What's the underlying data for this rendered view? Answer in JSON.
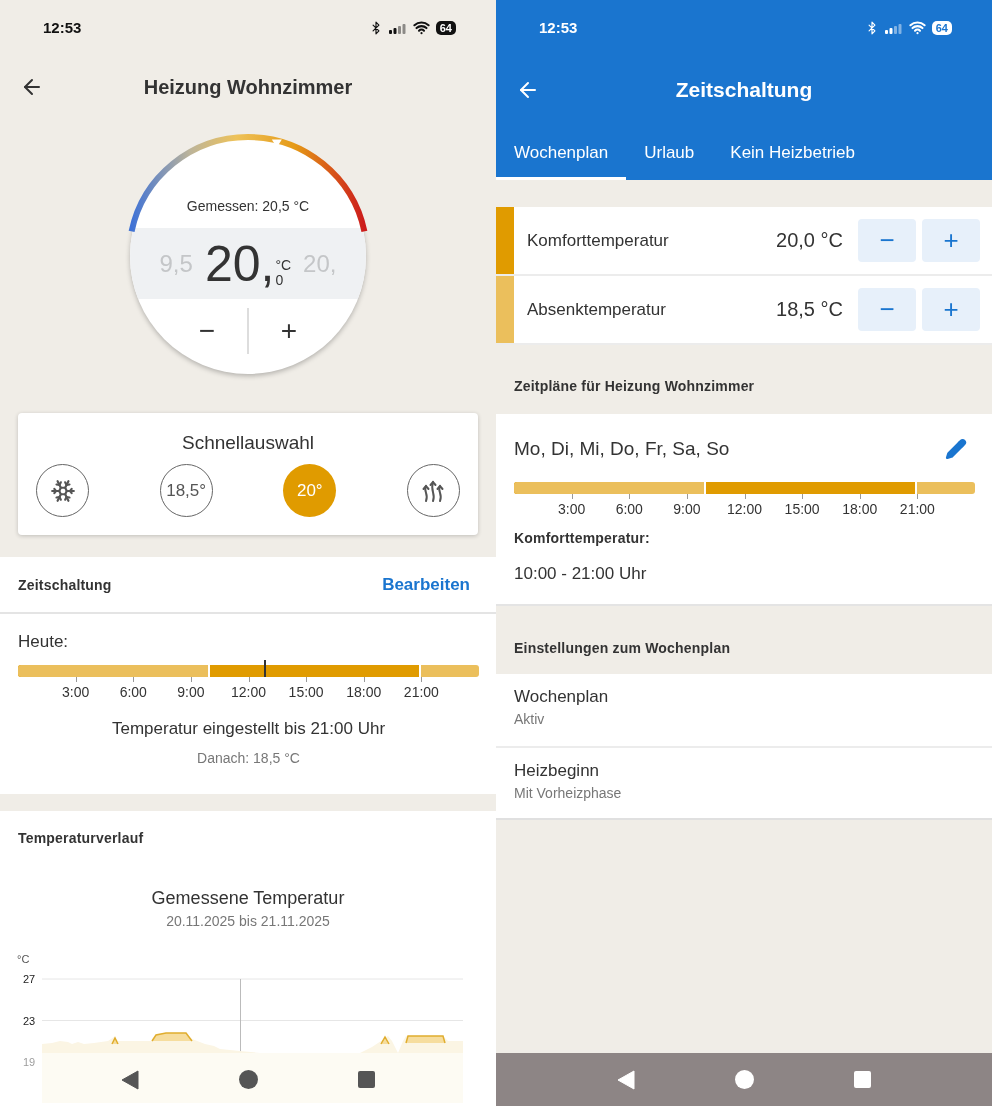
{
  "left": {
    "status_bar": {
      "time": "12:53",
      "battery": "64"
    },
    "header": {
      "title": "Heizung Wohnzimmer"
    },
    "dial": {
      "measured": "Gemessen: 20,5 °C",
      "previous": "9,5",
      "value": "20,",
      "decimal": "0",
      "unit": "°C",
      "next": "20,",
      "minus": "−",
      "plus": "+"
    },
    "quick_select": {
      "title": "Schnellauswahl",
      "options": [
        {
          "kind": "frost",
          "selected": false
        },
        {
          "kind": "text",
          "label": "18,5°",
          "selected": false
        },
        {
          "kind": "text",
          "label": "20°",
          "selected": true
        },
        {
          "kind": "boost",
          "selected": false
        }
      ]
    },
    "schedule": {
      "title": "Zeitschaltung",
      "action": "Bearbeiten",
      "day_label": "Heute:",
      "timeline": {
        "comfort_start": {
          "level": 0.4167
        },
        "comfort_end": {
          "level": 0.875
        },
        "now": {
          "level": 0.536
        },
        "ticks": [
          "3:00",
          "6:00",
          "9:00",
          "12:00",
          "15:00",
          "18:00",
          "21:00"
        ]
      },
      "status": "Temperatur eingestellt bis 21:00 Uhr",
      "after": "Danach: 18,5 °C"
    },
    "history": {
      "title": "Temperaturverlauf",
      "chart_title": "Gemessene Temperatur",
      "range": "20.11.2025 bis 21.11.2025",
      "unit": "°C",
      "y_ticks": [
        "27",
        "23",
        "19"
      ]
    }
  },
  "right": {
    "status_bar": {
      "time": "12:53",
      "battery": "64"
    },
    "header": {
      "title": "Zeitschaltung"
    },
    "tabs": [
      {
        "label": "Wochenplan",
        "selected": true
      },
      {
        "label": "Urlaub",
        "selected": false
      },
      {
        "label": "Kein Heizbetrieb",
        "selected": false
      }
    ],
    "temperatures": [
      {
        "kind": "komfort",
        "label": "Komforttemperatur",
        "value": "20,0 °C",
        "minus": "−",
        "plus": "+"
      },
      {
        "kind": "absenk",
        "label": "Absenktemperatur",
        "value": "18,5 °C",
        "minus": "−",
        "plus": "+"
      }
    ],
    "schedules_heading": "Zeitpläne für Heizung Wohnzimmer",
    "schedule": {
      "days": "Mo, Di, Mi, Do, Fr, Sa, So",
      "timeline": {
        "comfort_start": {
          "level": 0.4167
        },
        "comfort_end": {
          "level": 0.875
        },
        "ticks": [
          "3:00",
          "6:00",
          "9:00",
          "12:00",
          "15:00",
          "18:00",
          "21:00"
        ]
      },
      "period_label": "Komforttemperatur:",
      "period": "10:00 - 21:00 Uhr"
    },
    "settings_heading": "Einstellungen zum Wochenplan",
    "settings": [
      {
        "title": "Wochenplan",
        "value": "Aktiv"
      },
      {
        "title": "Heizbeginn",
        "value": "Mit Vorheizphase"
      }
    ]
  }
}
